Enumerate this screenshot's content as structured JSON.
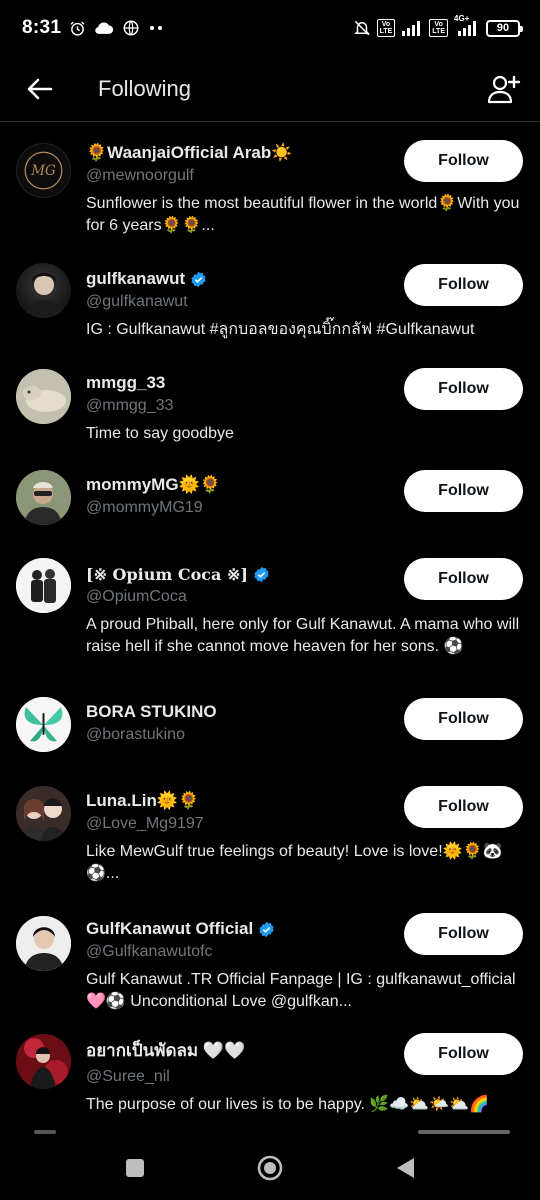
{
  "status_bar": {
    "time": "8:31",
    "battery": "90",
    "volte1": "Vo\nLTE",
    "volte2": "Vo\nLTE",
    "network": "4G+"
  },
  "header": {
    "title": "Following"
  },
  "accounts": [
    {
      "name": "🌻WaanjaiOfficial Arab☀️",
      "handle": "@mewnoorgulf",
      "bio": "Sunflower is the most beautiful flower in the world🌻With you for 6 years🌻🌻...",
      "follow_label": "Follow",
      "verified": false,
      "avatar_text": "MG"
    },
    {
      "name": "gulfkanawut",
      "handle": "@gulfkanawut",
      "bio": "IG : Gulfkanawut #ลูกบอลของคุณบิ๊กกลัฟ #Gulfkanawut",
      "follow_label": "Follow",
      "verified": true
    },
    {
      "name": "mmgg_33",
      "handle": "@mmgg_33",
      "bio": "Time to say goodbye",
      "follow_label": "Follow",
      "verified": false
    },
    {
      "name": "mommyMG🌞🌻",
      "handle": "@mommyMG19",
      "bio": "",
      "follow_label": "Follow",
      "verified": false
    },
    {
      "name": "[※ Opium Coca ※]",
      "handle": "@OpiumCoca",
      "bio": "A proud Phiball, here only for Gulf Kanawut. A mama who will raise hell if she cannot move heaven for her sons. ⚽",
      "follow_label": "Follow",
      "verified": true
    },
    {
      "name": "BORA STUKINO",
      "handle": "@borastukino",
      "bio": "",
      "follow_label": "Follow",
      "verified": false
    },
    {
      "name": "Luna.Lin🌞🌻",
      "handle": "@Love_Mg9197",
      "bio": "Like MewGulf true feelings of beauty!  Love is love!🌞🌻🐼⚽...",
      "follow_label": "Follow",
      "verified": false
    },
    {
      "name": "GulfKanawut Official",
      "handle": "@Gulfkanawutofc",
      "bio": "Gulf Kanawut .TR Official Fanpage | IG : gulfkanawut_official 🩷⚽ Unconditional Love @gulfkan...",
      "follow_label": "Follow",
      "verified": true
    },
    {
      "name": "อยากเป็นพัดลม 🤍🤍",
      "handle": "@Suree_nil",
      "bio": "The purpose of our lives is to be happy. 🌿☁️⛅🌤️⛅🌈",
      "follow_label": "Follow",
      "verified": false
    }
  ],
  "colors": {
    "background": "#000000",
    "text_primary": "#e7e9ea",
    "text_secondary": "#71767b",
    "verified": "#1d9bf0",
    "button_bg": "#ffffff",
    "button_text": "#0f1419"
  }
}
